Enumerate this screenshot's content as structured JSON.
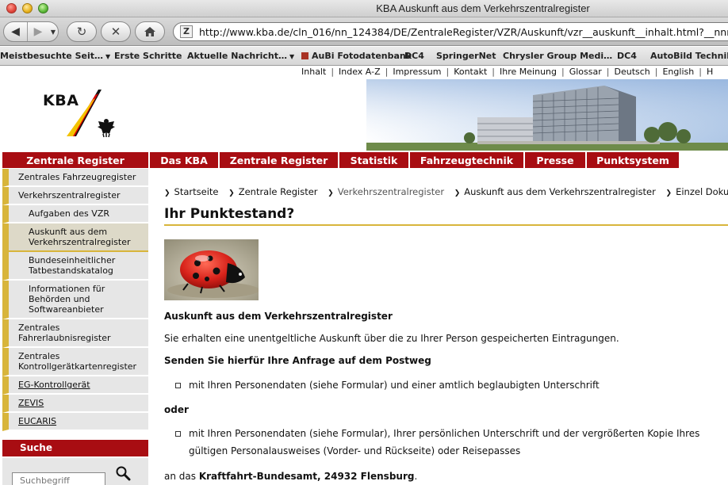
{
  "window": {
    "title": "KBA Auskunft aus dem Verkehrszentralregister"
  },
  "browser": {
    "url": "http://www.kba.de/cln_016/nn_124384/DE/ZentraleRegister/VZR/Auskunft/vzr__auskunft__inhalt.html?__nnn=true",
    "bookmarks": [
      {
        "label": "Meistbesuchte Seit…",
        "dropdown": true
      },
      {
        "label": "Erste Schritte"
      },
      {
        "label": "Aktuelle Nachricht…",
        "dropdown": true
      },
      {
        "label": "AuBi Fotodatenbank"
      },
      {
        "label": "DC4"
      },
      {
        "label": "SpringerNet"
      },
      {
        "label": "Chrysler Group Medi…"
      },
      {
        "label": "DC4"
      },
      {
        "label": "AutoBild Technik"
      }
    ]
  },
  "utility_nav": [
    "Inhalt",
    "Index A-Z",
    "Impressum",
    "Kontakt",
    "Ihre Meinung",
    "Glossar",
    "Deutsch",
    "English",
    "H"
  ],
  "logo": {
    "text": "KBA"
  },
  "main_nav": [
    {
      "label": "Zentrale Register"
    },
    {
      "label": "Das KBA"
    },
    {
      "label": "Zentrale Register"
    },
    {
      "label": "Statistik"
    },
    {
      "label": "Fahrzeugtechnik"
    },
    {
      "label": "Presse"
    },
    {
      "label": "Punktsystem"
    }
  ],
  "sidebar": [
    {
      "label": "Zentrales Fahrzeugregister",
      "level": 0
    },
    {
      "label": "Verkehrszentralregister",
      "level": 0
    },
    {
      "label": "Aufgaben des VZR",
      "level": 1
    },
    {
      "label": "Auskunft aus dem Verkehrszentralregister",
      "level": 1,
      "active": true
    },
    {
      "label": "Bundeseinheitlicher Tatbestandskatalog",
      "level": 1
    },
    {
      "label": "Informationen für Behörden und Softwareanbieter",
      "level": 1
    },
    {
      "label": "Zentrales Fahrerlaubnisregister",
      "level": 0
    },
    {
      "label": "Zentrales Kontrollgerätkartenregister",
      "level": 0
    },
    {
      "label": "EG-Kontrollgerät",
      "level": 0,
      "underline": true
    },
    {
      "label": "ZEVIS",
      "level": 0,
      "underline": true
    },
    {
      "label": "EUCARIS",
      "level": 0,
      "underline": true
    }
  ],
  "search": {
    "title": "Suche",
    "placeholder": "Suchbegriff"
  },
  "breadcrumb": [
    "Startseite",
    "Zentrale Register",
    "Verkehrszentralregister",
    "Auskunft aus dem Verkehrszentralregister",
    "Einzel Dokument"
  ],
  "content": {
    "title": "Ihr Punktestand?",
    "heading": "Auskunft aus dem Verkehrszentralregister",
    "intro": "Sie erhalten eine unentgeltliche Auskunft über die zu Ihrer Person gespeicherten Eintragungen.",
    "subheading": "Senden Sie hierfür Ihre Anfrage auf dem Postweg",
    "bullet1": "mit Ihren Personendaten (siehe Formular) und einer amtlich beglaubigten Unterschrift",
    "or": "oder",
    "bullet2_line1": "mit Ihren Personendaten (siehe Formular), Ihrer persönlichen Unterschrift und der vergrößerten Kopie Ihres",
    "bullet2_line2": "gültigen Personalausweises (Vorder- und Rückseite) oder Reisepasses",
    "address_prefix": "an das ",
    "address_bold": "Kraftfahrt-Bundesamt, 24932 Flensburg",
    "address_suffix": "."
  },
  "colors": {
    "brand_red": "#a80d12",
    "accent_gold": "#d8b53b",
    "sidebar_bg": "#e6e6e6"
  }
}
